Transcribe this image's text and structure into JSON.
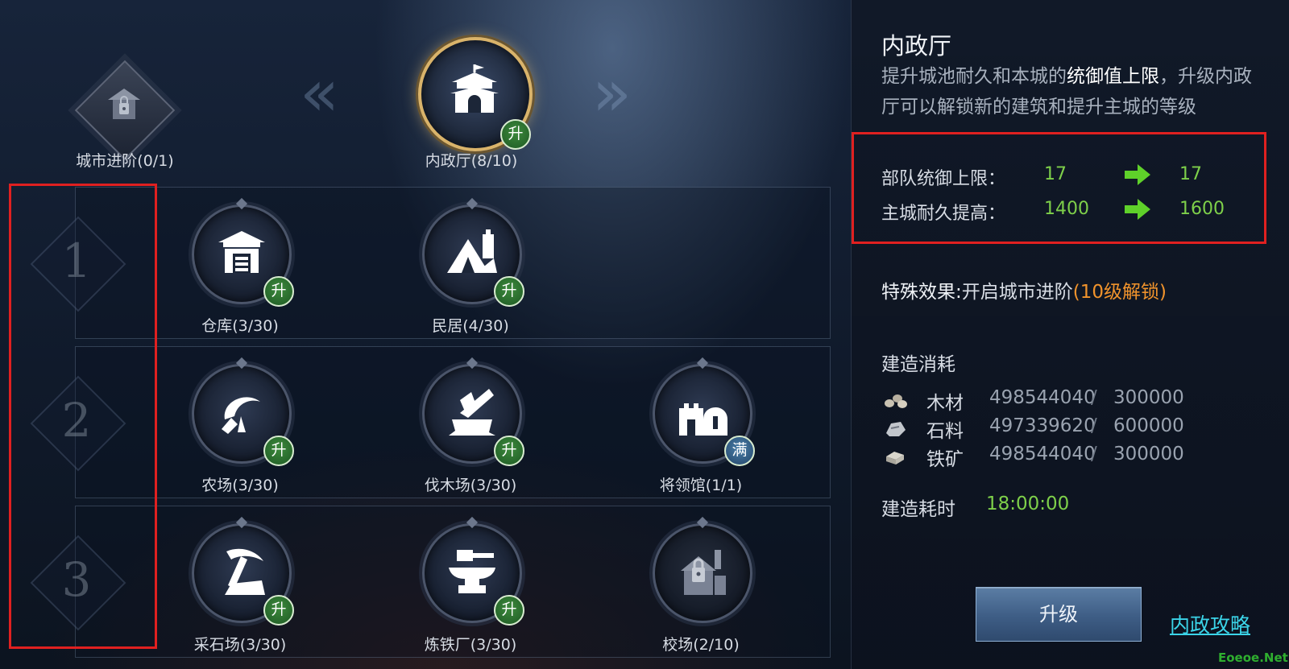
{
  "top": {
    "city_advance_label": "城市进阶(0/1)",
    "main_building_label": "内政厅(8/10)",
    "main_badge": "升"
  },
  "rows": {
    "row1": "1",
    "row2": "2",
    "row3": "3"
  },
  "buildings": {
    "warehouse": {
      "name": "仓库(3/30)",
      "badge": "升"
    },
    "residence": {
      "name": "民居(4/30)",
      "badge": "升"
    },
    "farm": {
      "name": "农场(3/30)",
      "badge": "升"
    },
    "lumber": {
      "name": "伐木场(3/30)",
      "badge": "升"
    },
    "general": {
      "name": "将领馆(1/1)",
      "badge": "满"
    },
    "quarry": {
      "name": "采石场(3/30)",
      "badge": "升"
    },
    "ironworks": {
      "name": "炼铁厂(3/30)",
      "badge": "升"
    },
    "drill": {
      "name": "校场(2/10)",
      "locked": true
    }
  },
  "panel": {
    "title": "内政厅",
    "desc_part1": "提升城池耐久和本城的",
    "desc_highlight": "统御值上限",
    "desc_part2": "，升级内政厅可以解锁新的建筑和提升主城的等级",
    "stats": [
      {
        "label": "部队统御上限：",
        "from": "17",
        "to": "17"
      },
      {
        "label": "主城耐久提高：",
        "from": "1400",
        "to": "1600"
      }
    ],
    "special_label": "特殊效果:",
    "special_text": "开启城市进阶",
    "special_unlock": "(10级解锁)",
    "cost_title": "建造消耗",
    "resources": [
      {
        "name": "木材",
        "have": "498544040",
        "sep": "/",
        "need": "300000",
        "icon": "wood-icon"
      },
      {
        "name": "石料",
        "have": "497339620",
        "sep": "/",
        "need": "600000",
        "icon": "stone-icon"
      },
      {
        "name": "铁矿",
        "have": "498544040",
        "sep": "/",
        "need": "300000",
        "icon": "iron-icon"
      }
    ],
    "time_label": "建造耗时",
    "time_value": "18:00:00",
    "upgrade_button": "升级",
    "guide_link": "内政攻略"
  },
  "watermark": "Eoeoe.Net",
  "colors": {
    "accent_green": "#7ed04a",
    "unlock_orange": "#f0932c",
    "link_cyan": "#3bd4e8",
    "highlight_red": "#e02020"
  }
}
